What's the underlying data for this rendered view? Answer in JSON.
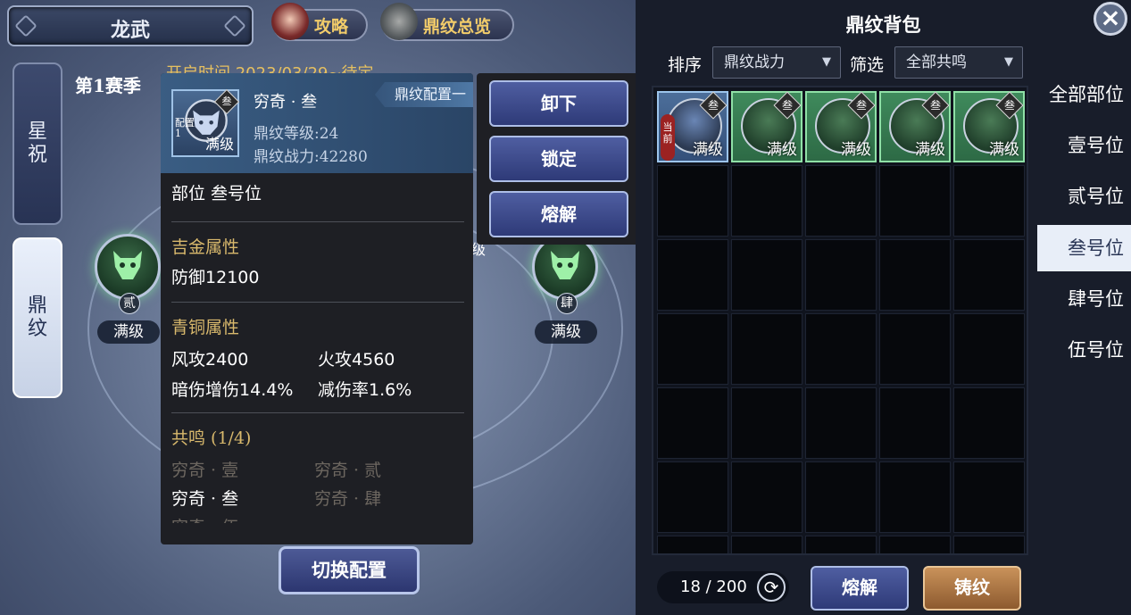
{
  "header": {
    "title": "龙武",
    "strategy_label": "攻略",
    "overview_label": "鼎纹总览"
  },
  "season": {
    "label": "第1赛季",
    "open_time": "开启时间 2023/03/29~待定"
  },
  "side_tabs": [
    {
      "label": "星\n祝"
    },
    {
      "label": "鼎\n纹"
    }
  ],
  "slots": {
    "left": {
      "badge": "贰",
      "level": "满级"
    },
    "right": {
      "badge": "肆",
      "level": "满级"
    },
    "mid_level_partial": "级"
  },
  "switch_button": "切换配置",
  "tooltip": {
    "config_tag": "鼎纹配置一",
    "icon_config_label": "配置\n1",
    "icon_tier": "叁",
    "icon_level": "满级",
    "name": "穷奇 · 叁",
    "level_line": "鼎纹等级:24",
    "power_line": "鼎纹战力:42280",
    "position": "部位 叁号位",
    "jijin": {
      "title": "吉金属性",
      "stat": "防御",
      "value": "12100"
    },
    "qingtong": {
      "title": "青铜属性",
      "stats": [
        {
          "name": "风攻",
          "value": "2400"
        },
        {
          "name": "火攻",
          "value": "4560"
        },
        {
          "name": "暗伤增伤",
          "value": "14.4%"
        },
        {
          "name": "减伤率",
          "value": "1.6%"
        }
      ]
    },
    "resonance": {
      "title": "共鸣 (1/4)",
      "items": [
        "穷奇 · 壹",
        "穷奇 · 贰",
        "穷奇 · 叁",
        "穷奇 · 肆"
      ],
      "cut_off": "穷奇 · 伍"
    }
  },
  "actions": {
    "unequip": "卸下",
    "lock": "锁定",
    "dismantle": "熔解"
  },
  "bag": {
    "title": "鼎纹背包",
    "sort_label": "排序",
    "sort_value": "鼎纹战力",
    "filter_label": "筛选",
    "filter_value": "全部共鸣",
    "items": [
      {
        "tier": "叁",
        "level": "满级",
        "current": "当\n前"
      },
      {
        "tier": "叁",
        "level": "满级"
      },
      {
        "tier": "叁",
        "level": "满级"
      },
      {
        "tier": "叁",
        "level": "满级"
      },
      {
        "tier": "叁",
        "level": "满级"
      }
    ],
    "count": "18 / 200",
    "dismantle_label": "熔解",
    "forge_label": "铸纹"
  },
  "positions": [
    "全部部位",
    "壹号位",
    "贰号位",
    "叁号位",
    "肆号位",
    "伍号位"
  ],
  "colors": {
    "gold": "#d8b86c",
    "selected_position": "#e8eef8",
    "current_tag": "#9b2222",
    "forge_button": "#b8804a"
  }
}
